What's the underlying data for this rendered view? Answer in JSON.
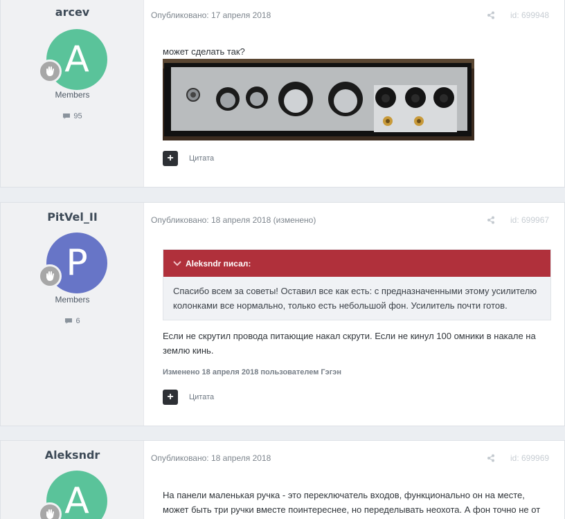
{
  "posts": [
    {
      "author": "arcev",
      "avatar_letter": "A",
      "avatar_color": "#5ac39a",
      "group": "Members",
      "post_count": "95",
      "published": "Опубликовано: 17 апреля 2018",
      "post_id": "id: 699948",
      "text": "может сделать так?",
      "quote_label": "Цитата"
    },
    {
      "author": "PitVel_II",
      "avatar_letter": "P",
      "avatar_color": "#6775c7",
      "group": "Members",
      "post_count": "6",
      "published": "Опубликовано: 18 апреля 2018 (изменено)",
      "post_id": "id: 699967",
      "quote": {
        "author_line": "Aleksndr писал:",
        "text": "Спасибо всем за советы! Оставил все как есть: с предназначенными этому усилителю колонками все нормально, только есть небольшой фон. Усилитель почти готов."
      },
      "text": "Если не скрутил провода питающие накал скрути. Если не кинул 100 омники в накале на землю кинь.",
      "edited": "Изменено 18 апреля 2018 пользователем Гэгэн",
      "quote_label": "Цитата"
    },
    {
      "author": "Aleksndr",
      "avatar_letter": "A",
      "avatar_color": "#5ac39a",
      "published": "Опубликовано: 18 апреля 2018",
      "post_id": "id: 699969",
      "text": "На панели маленькая ручка - это переключатель входов, функционально он на месте, может быть три ручки вместе поинтереснее, но переделывать неохота. А фон точно не от"
    }
  ],
  "colors": {
    "quote_header": "#b0303b",
    "accent_green": "#5ac39a",
    "accent_blue": "#6775c7"
  },
  "icons": [
    "rank-badge-icon",
    "comment-icon",
    "share-icon",
    "chevron-down-icon",
    "plus-icon"
  ]
}
